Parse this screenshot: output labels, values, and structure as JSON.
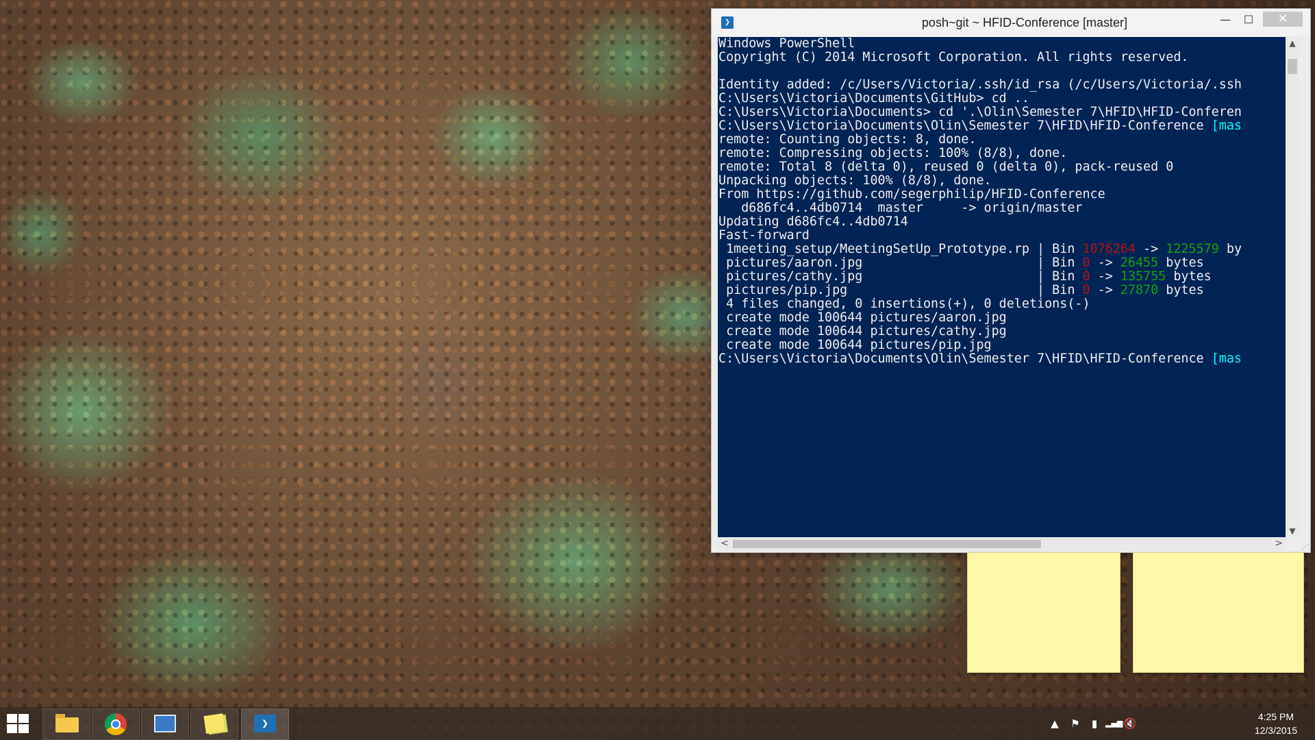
{
  "window": {
    "title": "posh~git ~ HFID-Conference [master]",
    "app_icon_glyph": "❯",
    "minimize_glyph": "—",
    "maximize_glyph": "☐",
    "close_glyph": "✕"
  },
  "console": {
    "background": "#012456",
    "lines": [
      {
        "segments": [
          {
            "t": "Windows PowerShell"
          }
        ]
      },
      {
        "segments": [
          {
            "t": "Copyright (C) 2014 Microsoft Corporation. All rights reserved."
          }
        ]
      },
      {
        "segments": [
          {
            "t": ""
          }
        ]
      },
      {
        "segments": [
          {
            "t": "Identity added: /c/Users/Victoria/.ssh/id_rsa (/c/Users/Victoria/.ssh"
          }
        ]
      },
      {
        "segments": [
          {
            "t": "C:\\Users\\Victoria\\Documents\\GitHub> cd .."
          }
        ]
      },
      {
        "segments": [
          {
            "t": "C:\\Users\\Victoria\\Documents> cd '.\\Olin\\Semester 7\\HFID\\HFID-Conferen"
          }
        ]
      },
      {
        "segments": [
          {
            "t": "C:\\Users\\Victoria\\Documents\\Olin\\Semester 7\\HFID\\HFID-Conference "
          },
          {
            "t": "[mas",
            "c": "cyan"
          }
        ]
      },
      {
        "segments": [
          {
            "t": "remote: Counting objects: 8, done."
          }
        ]
      },
      {
        "segments": [
          {
            "t": "remote: Compressing objects: 100% (8/8), done."
          }
        ]
      },
      {
        "segments": [
          {
            "t": "remote: Total 8 (delta 0), reused 0 (delta 0), pack-reused 0"
          }
        ]
      },
      {
        "segments": [
          {
            "t": "Unpacking objects: 100% (8/8), done."
          }
        ]
      },
      {
        "segments": [
          {
            "t": "From https://github.com/segerphilip/HFID-Conference"
          }
        ]
      },
      {
        "segments": [
          {
            "t": "   d686fc4..4db0714  master     -> origin/master"
          }
        ]
      },
      {
        "segments": [
          {
            "t": "Updating d686fc4..4db0714"
          }
        ]
      },
      {
        "segments": [
          {
            "t": "Fast-forward"
          }
        ]
      },
      {
        "segments": [
          {
            "t": " 1meeting_setup/MeetingSetUp_Prototype.rp | Bin "
          },
          {
            "t": "1076264",
            "c": "red"
          },
          {
            "t": " -> "
          },
          {
            "t": "1225579",
            "c": "green"
          },
          {
            "t": " by"
          }
        ]
      },
      {
        "segments": [
          {
            "t": " pictures/aaron.jpg                       | Bin "
          },
          {
            "t": "0",
            "c": "red"
          },
          {
            "t": " -> "
          },
          {
            "t": "26455",
            "c": "green"
          },
          {
            "t": " bytes"
          }
        ]
      },
      {
        "segments": [
          {
            "t": " pictures/cathy.jpg                       | Bin "
          },
          {
            "t": "0",
            "c": "red"
          },
          {
            "t": " -> "
          },
          {
            "t": "135755",
            "c": "green"
          },
          {
            "t": " bytes"
          }
        ]
      },
      {
        "segments": [
          {
            "t": " pictures/pip.jpg                         | Bin "
          },
          {
            "t": "0",
            "c": "red"
          },
          {
            "t": " -> "
          },
          {
            "t": "27870",
            "c": "green"
          },
          {
            "t": " bytes"
          }
        ]
      },
      {
        "segments": [
          {
            "t": " 4 files changed, 0 insertions(+), 0 deletions(-)"
          }
        ]
      },
      {
        "segments": [
          {
            "t": " create mode 100644 pictures/aaron.jpg"
          }
        ]
      },
      {
        "segments": [
          {
            "t": " create mode 100644 pictures/cathy.jpg"
          }
        ]
      },
      {
        "segments": [
          {
            "t": " create mode 100644 pictures/pip.jpg"
          }
        ]
      },
      {
        "segments": [
          {
            "t": "C:\\Users\\Victoria\\Documents\\Olin\\Semester 7\\HFID\\HFID-Conference "
          },
          {
            "t": "[mas",
            "c": "cyan"
          }
        ]
      }
    ]
  },
  "scrollbars": {
    "up_glyph": "▲",
    "down_glyph": "▼",
    "left_glyph": "<",
    "right_glyph": ">"
  },
  "taskbar": {
    "items": [
      {
        "name": "file-explorer",
        "icon": "folder-icon"
      },
      {
        "name": "chrome",
        "icon": "chrome-icon"
      },
      {
        "name": "control-panel",
        "icon": "control-panel-icon"
      },
      {
        "name": "sticky-notes",
        "icon": "sticky-notes-icon"
      },
      {
        "name": "powershell",
        "icon": "powershell-icon",
        "glyph": "❯"
      }
    ],
    "tray": {
      "chevron": "▲",
      "flag": "⚑",
      "battery": "▮",
      "signal": "▂▄▆",
      "volume": "🔇"
    },
    "clock": {
      "time": "4:25 PM",
      "date": "12/3/2015"
    }
  }
}
